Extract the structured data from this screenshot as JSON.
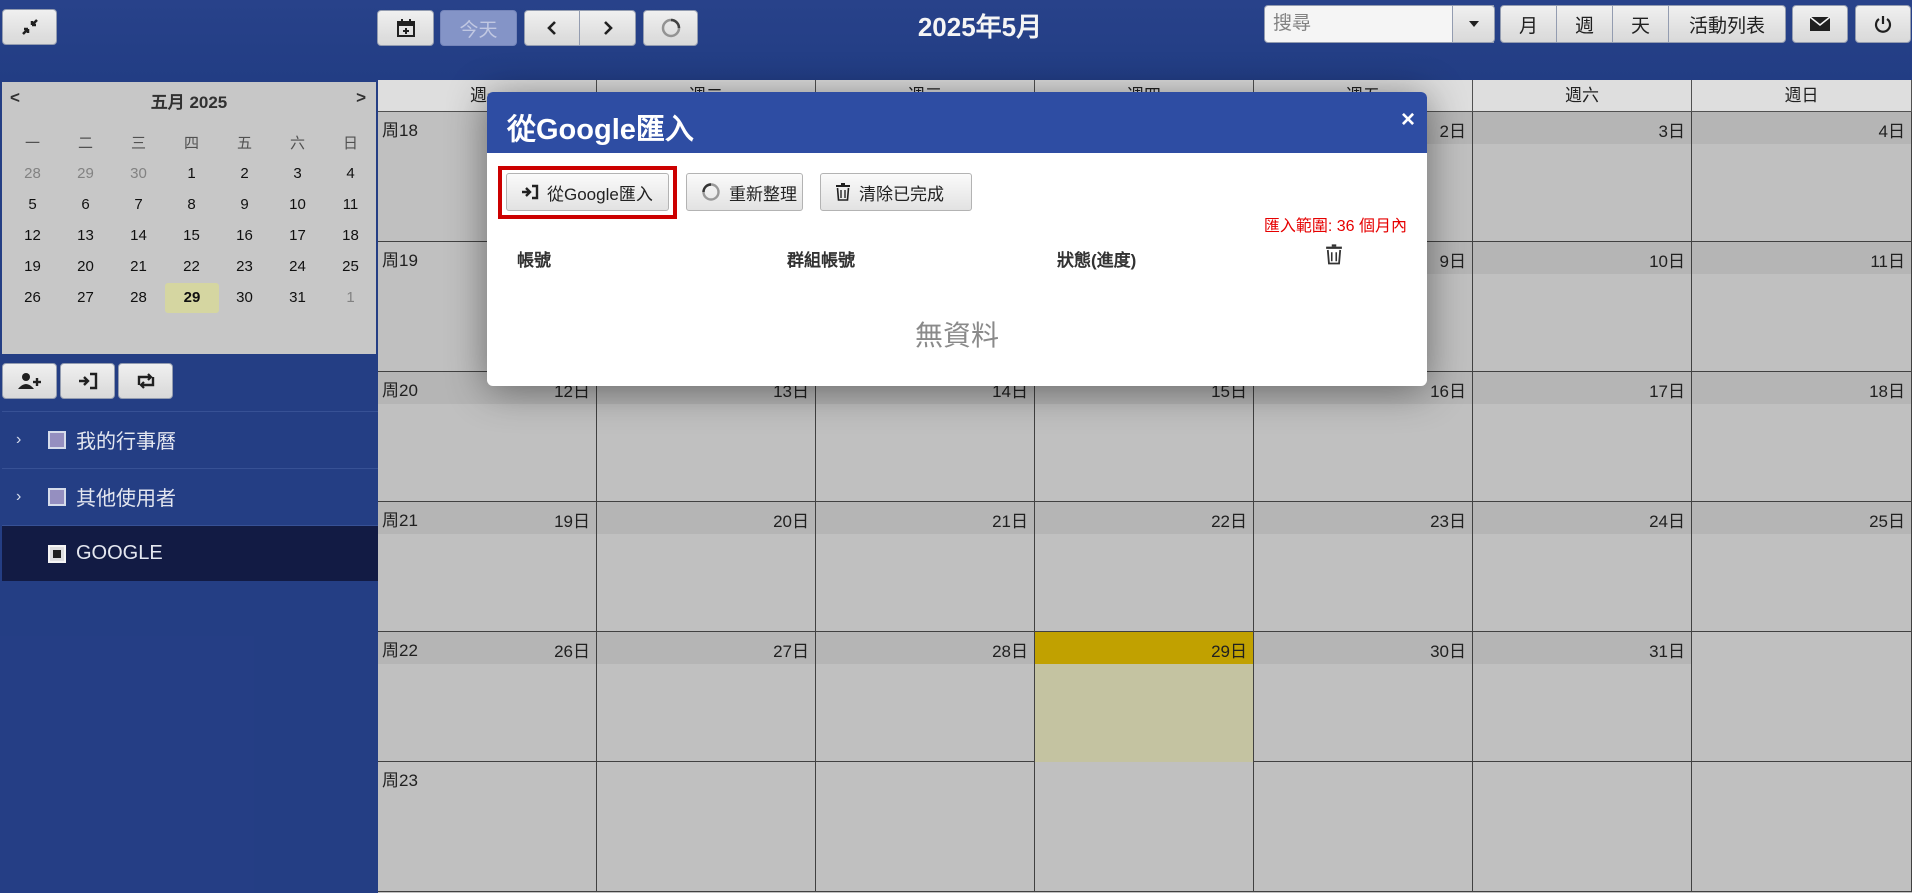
{
  "toolbar": {
    "today_label": "今天",
    "title": "2025年5月",
    "search_placeholder": "搜尋",
    "view_month": "月",
    "view_week": "週",
    "view_day": "天",
    "view_list": "活動列表"
  },
  "mini_calendar": {
    "prev": "<",
    "next": ">",
    "title": "五月 2025",
    "dow": [
      "一",
      "二",
      "三",
      "四",
      "五",
      "六",
      "日"
    ],
    "weeks": [
      [
        "28",
        "29",
        "30",
        "1",
        "2",
        "3",
        "4"
      ],
      [
        "5",
        "6",
        "7",
        "8",
        "9",
        "10",
        "11"
      ],
      [
        "12",
        "13",
        "14",
        "15",
        "16",
        "17",
        "18"
      ],
      [
        "19",
        "20",
        "21",
        "22",
        "23",
        "24",
        "25"
      ],
      [
        "26",
        "27",
        "28",
        "29",
        "30",
        "31",
        "1"
      ]
    ],
    "today": "29"
  },
  "sidebar": {
    "items": [
      {
        "label": "我的行事曆"
      },
      {
        "label": "其他使用者"
      },
      {
        "label": "GOOGLE"
      }
    ]
  },
  "calendar": {
    "dow": [
      "週一",
      "週二",
      "週三",
      "週四",
      "週五",
      "週六",
      "週日"
    ],
    "weeks": [
      {
        "label": "周18",
        "days": [
          "",
          "",
          "",
          "",
          "2日",
          "3日",
          "4日"
        ]
      },
      {
        "label": "周19",
        "days": [
          "",
          "",
          "",
          "",
          "9日",
          "10日",
          "11日"
        ]
      },
      {
        "label": "周20",
        "days": [
          "12日",
          "13日",
          "14日",
          "15日",
          "16日",
          "17日",
          "18日"
        ]
      },
      {
        "label": "周21",
        "days": [
          "19日",
          "20日",
          "21日",
          "22日",
          "23日",
          "24日",
          "25日"
        ]
      },
      {
        "label": "周22",
        "days": [
          "26日",
          "27日",
          "28日",
          "29日",
          "30日",
          "31日",
          ""
        ]
      },
      {
        "label": "周23",
        "days": [
          "",
          "",
          "",
          "",
          "",
          "",
          ""
        ]
      }
    ],
    "today_label": "29日"
  },
  "modal": {
    "title": "從Google匯入",
    "close": "×",
    "btn_import": "從Google匯入",
    "btn_refresh": "重新整理",
    "btn_clear": "清除已完成",
    "import_range": "匯入範圍: 36 個月內",
    "col_account": "帳號",
    "col_group": "群組帳號",
    "col_status": "狀態(進度)",
    "empty": "無資料"
  },
  "colors": {
    "header_blue": "#2e4da3",
    "sidebar_blue": "#26418a",
    "today_yellow": "#c9a800",
    "highlight_red": "#cc0000",
    "range_red": "#e60000"
  }
}
